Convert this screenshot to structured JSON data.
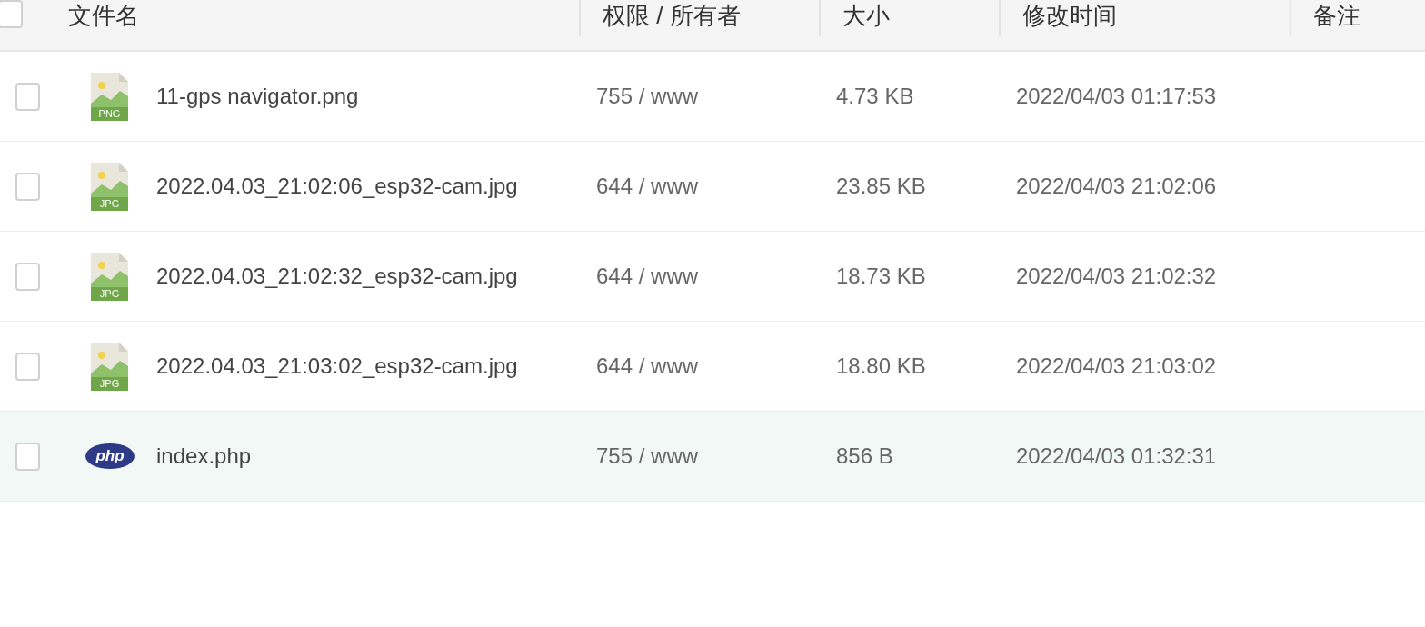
{
  "table": {
    "columns": [
      {
        "label": "文件名"
      },
      {
        "label": "权限 / 所有者"
      },
      {
        "label": "大小"
      },
      {
        "label": "修改时间"
      },
      {
        "label": "备注"
      }
    ],
    "header_checkbox": {
      "checked": false
    },
    "rows": [
      {
        "kind": "image",
        "icon_label": "PNG",
        "name": "11-gps navigator.png",
        "permissions": "755 / www",
        "size": "4.73 KB",
        "modified": "2022/04/03 01:17:53",
        "checked": false,
        "highlighted": false
      },
      {
        "kind": "image",
        "icon_label": "JPG",
        "name": "2022.04.03_21:02:06_esp32-cam.jpg",
        "permissions": "644 / www",
        "size": "23.85 KB",
        "modified": "2022/04/03 21:02:06",
        "checked": false,
        "highlighted": false
      },
      {
        "kind": "image",
        "icon_label": "JPG",
        "name": "2022.04.03_21:02:32_esp32-cam.jpg",
        "permissions": "644 / www",
        "size": "18.73 KB",
        "modified": "2022/04/03 21:02:32",
        "checked": false,
        "highlighted": false
      },
      {
        "kind": "image",
        "icon_label": "JPG",
        "name": "2022.04.03_21:03:02_esp32-cam.jpg",
        "permissions": "644 / www",
        "size": "18.80 KB",
        "modified": "2022/04/03 21:03:02",
        "checked": false,
        "highlighted": false
      },
      {
        "kind": "php",
        "icon_label": "php",
        "name": "index.php",
        "permissions": "755 / www",
        "size": "856 B",
        "modified": "2022/04/03 01:32:31",
        "checked": false,
        "highlighted": true
      }
    ]
  }
}
